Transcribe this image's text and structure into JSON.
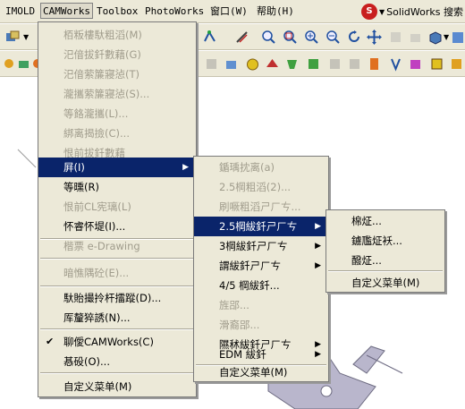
{
  "menubar": {
    "items": [
      "IMOLD",
      "CAMWorks",
      "Toolbox",
      "PhotoWorks",
      "窗口(W)",
      "帮助(H)"
    ],
    "brand": "SolidWorks 搜索"
  },
  "toolbar": {
    "icons": [
      "display-style-icon",
      "rotate-icon",
      "zoom-fit-icon",
      "zoom-area-icon",
      "zoom-in-out-icon",
      "zoom-selection-icon",
      "rotate-view-icon",
      "pan-icon",
      "view-orientation-icon",
      "shaded-icon"
    ]
  },
  "camworks_menu": {
    "items": [
      {
        "label": "栢粄樓馱粗滔(M)",
        "enabled": false
      },
      {
        "label": "汜偣拔釺數藉(G)",
        "enabled": false
      },
      {
        "label": "汜偣萦簾寢惉(T)",
        "enabled": false
      },
      {
        "label": "瀧攜萦簾寢惉(S)...",
        "enabled": false
      },
      {
        "label": "等餎瀧攜(L)...",
        "enabled": false
      },
      {
        "label": "綁离揭撿(C)...",
        "enabled": false
      },
      {
        "label": "恨前拔釺數藉",
        "enabled": false
      },
      {
        "label": "屛(I)",
        "enabled": true,
        "highlighted": true,
        "submenu": true
      },
      {
        "label": "等曛(R)",
        "enabled": true
      },
      {
        "label": "恨前CL宪璃(L)",
        "enabled": false
      },
      {
        "label": "怀睿怀堤(I)...",
        "enabled": true
      },
      {
        "label": "楷票 e-Drawing",
        "enabled": false
      },
      {
        "label": "暗憔隅砼(E)...",
        "enabled": false
      },
      {
        "label": "馱貽撮拎杆擂蹤(D)...",
        "enabled": true
      },
      {
        "label": "厍釐猝誘(N)...",
        "enabled": true
      },
      {
        "label": "聊僾CAMWorks(C)",
        "enabled": true,
        "checked": true
      },
      {
        "label": "惎砓(O)...",
        "enabled": true
      },
      {
        "label": "自定义菜单(M)",
        "enabled": true
      }
    ]
  },
  "insert_submenu": {
    "items": [
      {
        "label": "鍎瑀抌离(a)",
        "enabled": false
      },
      {
        "label": "2.5棡粗滔(2)...",
        "enabled": false
      },
      {
        "label": "刷噘粗滔ㄕㄏㄘ...",
        "enabled": false
      },
      {
        "label": "2.5棡紱釺ㄕㄏㄘ",
        "enabled": true,
        "highlighted": true,
        "submenu": true
      },
      {
        "label": "3棡紱釺ㄕㄏㄘ",
        "enabled": true,
        "submenu": true
      },
      {
        "label": "謂紱釺ㄕㄏㄘ",
        "enabled": true,
        "submenu": true
      },
      {
        "label": "4/5 棡紱釺...",
        "enabled": true
      },
      {
        "label": "旌郘...",
        "enabled": false
      },
      {
        "label": "滑裔郘...",
        "enabled": false
      },
      {
        "label": "隰秫紱釺ㄕㄏㄘ",
        "enabled": true,
        "submenu": true
      },
      {
        "label": "EDM 紱釺",
        "enabled": true,
        "submenu": true
      },
      {
        "label": "自定义菜单(M)",
        "enabled": true
      }
    ]
  },
  "ops_submenu": {
    "items": [
      {
        "label": "棉炡..."
      },
      {
        "label": "鐪尶炡袄..."
      },
      {
        "label": "醱炡..."
      },
      {
        "label": "自定义菜单(M)"
      }
    ]
  }
}
